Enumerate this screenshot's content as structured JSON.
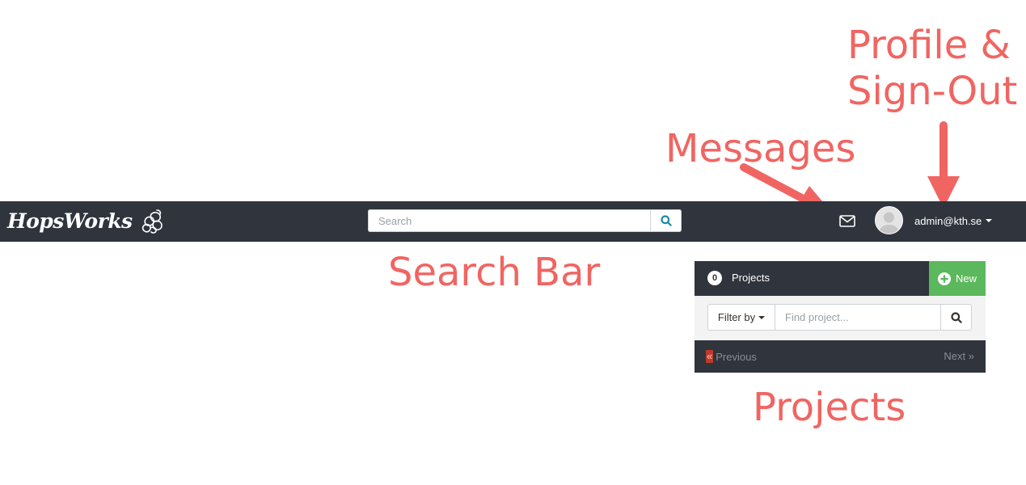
{
  "annotations": {
    "profile_line1": "Profile &",
    "profile_line2": "Sign-Out",
    "messages": "Messages",
    "search_bar": "Search Bar",
    "projects": "Projects"
  },
  "navbar": {
    "logo_text": "HopsWorks",
    "search": {
      "placeholder": "Search"
    },
    "user": {
      "email": "admin@kth.se"
    },
    "icons": [
      "hop-cone-icon",
      "search-icon",
      "envelope-icon",
      "user-avatar",
      "caret-down-icon"
    ]
  },
  "projects_panel": {
    "count": "0",
    "title": "Projects",
    "new_label": "New",
    "filter_label": "Filter by",
    "find_placeholder": "Find project...",
    "prev_symbol": "«",
    "prev_label": "Previous",
    "next_label": "Next »"
  },
  "colors": {
    "navbar_bg": "#2f343d",
    "annotation": "#f06562",
    "new_button": "#5cb85c",
    "search_icon": "#1d8aa5"
  }
}
